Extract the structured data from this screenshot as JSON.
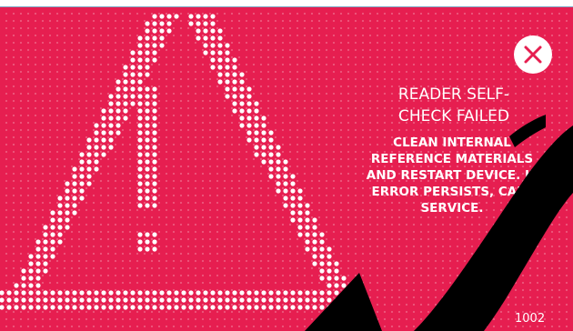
{
  "screen": {
    "background_color": "#e61e50",
    "foreground_color": "#ffffff",
    "warning_graphic": "dotted-warning-triangle-icon",
    "close_button": {
      "icon": "close-icon",
      "color": "#e61e50"
    },
    "title": "READER SELF-CHECK FAILED",
    "message": "CLEAN INTERNAL REFERENCE MATERIALS AND RESTART DEVICE. IF ERROR PERSISTS, CALL SERVICE.",
    "error_code": "1002"
  }
}
